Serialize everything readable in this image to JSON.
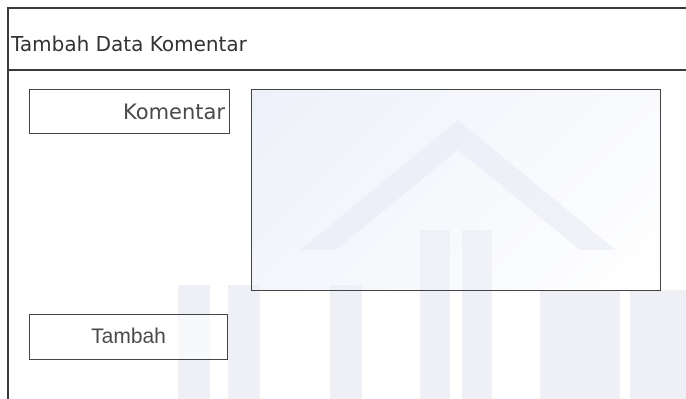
{
  "window": {
    "title": "Tambah Data Komentar"
  },
  "form": {
    "comment_label": "Komentar",
    "comment_value": "",
    "submit_label": "Tambah"
  },
  "colors": {
    "border": "#3a3a3a",
    "text": "#4a4a4a",
    "watermark": "#e8eaf2"
  }
}
